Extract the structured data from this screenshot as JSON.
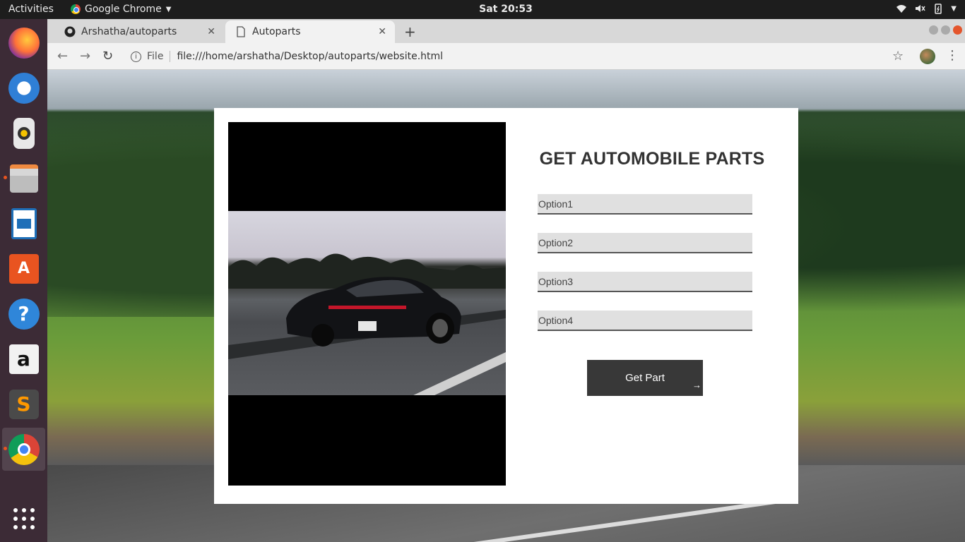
{
  "topbar": {
    "activities": "Activities",
    "app_name": "Google Chrome",
    "clock": "Sat 20:53"
  },
  "dock": {
    "items": [
      {
        "name": "firefox"
      },
      {
        "name": "thunderbird"
      },
      {
        "name": "rhythmbox"
      },
      {
        "name": "files"
      },
      {
        "name": "libreoffice-writer"
      },
      {
        "name": "ubuntu-software"
      },
      {
        "name": "help"
      },
      {
        "name": "amazon"
      },
      {
        "name": "sublime-text"
      },
      {
        "name": "google-chrome"
      },
      {
        "name": "show-applications"
      }
    ]
  },
  "browser": {
    "tabs": [
      {
        "title": "Arshatha/autoparts",
        "icon": "github-icon",
        "active": false
      },
      {
        "title": "Autoparts",
        "icon": "page-icon",
        "active": true
      }
    ],
    "new_tab": "+",
    "address": {
      "scheme_label": "File",
      "url": "file:///home/arshatha/Desktop/autoparts/website.html"
    }
  },
  "page": {
    "heading": "GET AUTOMOBILE PARTS",
    "options": [
      "Option1",
      "Option2",
      "Option3",
      "Option4"
    ],
    "button_label": "Get Part",
    "button_arrow": "→"
  },
  "colors": {
    "dock_bg": "#3c2b36",
    "topbar_bg": "#1d1d1d",
    "button_bg": "#383838",
    "field_bg": "#e0e0e0",
    "accent_dot": "#e95420"
  }
}
